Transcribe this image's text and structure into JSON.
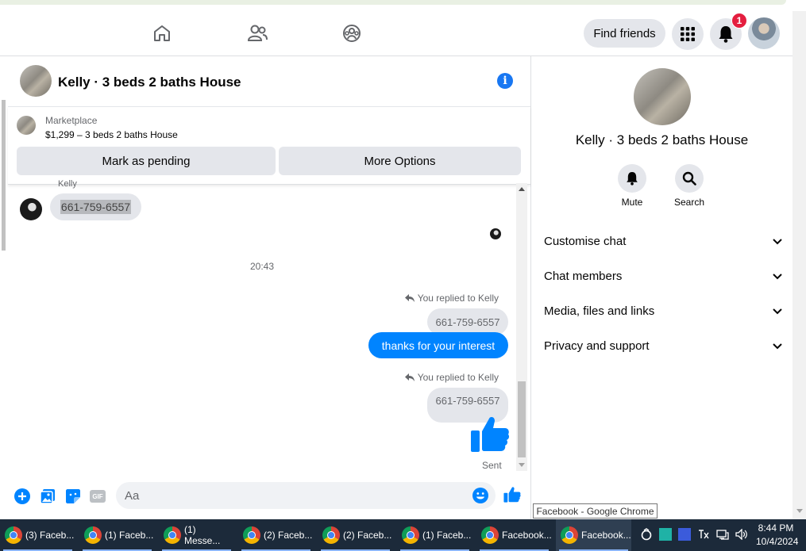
{
  "header": {
    "find_friends": "Find friends",
    "notification_count": "1"
  },
  "chat": {
    "title": "Kelly · 3 beds 2 baths House",
    "marketplace": {
      "label": "Marketplace",
      "listing": "$1,299 – 3 beds 2 baths House",
      "mark_pending": "Mark as pending",
      "more_options": "More Options"
    },
    "messages": {
      "sender_name": "Kelly",
      "phone_message": "661-759-6557",
      "timestamp": "20:43",
      "reply1_label": "You replied to Kelly",
      "reply1_quote": "661-759-6557",
      "reply1_text": "thanks for your interest",
      "reply2_label": "You replied to Kelly",
      "reply2_quote": "661-759-6557",
      "status": "Sent"
    },
    "composer": {
      "placeholder": "Aa",
      "gif": "GIF"
    }
  },
  "right_panel": {
    "title": "Kelly · 3 beds 2 baths House",
    "actions": [
      {
        "label": "Mute",
        "icon": "bell-icon"
      },
      {
        "label": "Search",
        "icon": "search-icon"
      }
    ],
    "sections": [
      {
        "label": "Customise chat"
      },
      {
        "label": "Chat members"
      },
      {
        "label": "Media, files and links"
      },
      {
        "label": "Privacy and support"
      }
    ]
  },
  "tooltip": "Facebook - Google Chrome",
  "taskbar": {
    "items": [
      {
        "label": "(3) Faceb..."
      },
      {
        "label": "(1) Faceb..."
      },
      {
        "label": "(1) Messe..."
      },
      {
        "label": "(2) Faceb..."
      },
      {
        "label": "(2) Faceb..."
      },
      {
        "label": "(1) Faceb..."
      },
      {
        "label": "Facebook..."
      },
      {
        "label": "Facebook..."
      }
    ],
    "time": "8:44 PM",
    "date": "10/4/2024"
  },
  "colors": {
    "accent": "#0084ff",
    "fb_blue": "#1877f2",
    "badge": "#e41e3f",
    "taskbar": "#1c2a3a"
  }
}
